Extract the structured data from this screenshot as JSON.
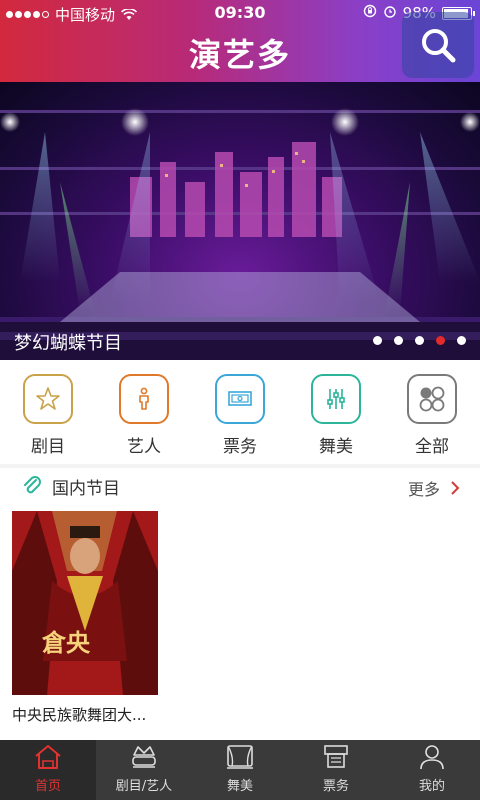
{
  "status_bar": {
    "carrier": "中国移动",
    "time": "09:30",
    "battery": "98%"
  },
  "header": {
    "title": "演艺多",
    "search_icon": "search-icon"
  },
  "banner": {
    "caption": "梦幻蝴蝶节目",
    "page_count": 5,
    "active_page": 4
  },
  "categories": [
    {
      "label": "剧目",
      "icon": "star-icon",
      "color": "#c9a24a"
    },
    {
      "label": "艺人",
      "icon": "person-icon",
      "color": "#e07a2a"
    },
    {
      "label": "票务",
      "icon": "ticket-icon",
      "color": "#3aa7d8"
    },
    {
      "label": "舞美",
      "icon": "sliders-icon",
      "color": "#2bb59a"
    },
    {
      "label": "全部",
      "icon": "grid-icon",
      "color": "#7a7a7a"
    }
  ],
  "section": {
    "title": "国内节目",
    "more": "更多",
    "items": [
      {
        "caption": "中央民族歌舞团大...",
        "poster_text": "倉央"
      }
    ]
  },
  "tabbar": [
    {
      "label": "首页",
      "icon": "home-icon",
      "active": true
    },
    {
      "label": "剧目/艺人",
      "icon": "crown-icon",
      "active": false
    },
    {
      "label": "舞美",
      "icon": "stage-icon",
      "active": false
    },
    {
      "label": "票务",
      "icon": "ticket-box-icon",
      "active": false
    },
    {
      "label": "我的",
      "icon": "user-icon",
      "active": false
    }
  ],
  "colors": {
    "header_start": "#d2293d",
    "header_end": "#6a45d6",
    "accent_red": "#e0322f"
  }
}
